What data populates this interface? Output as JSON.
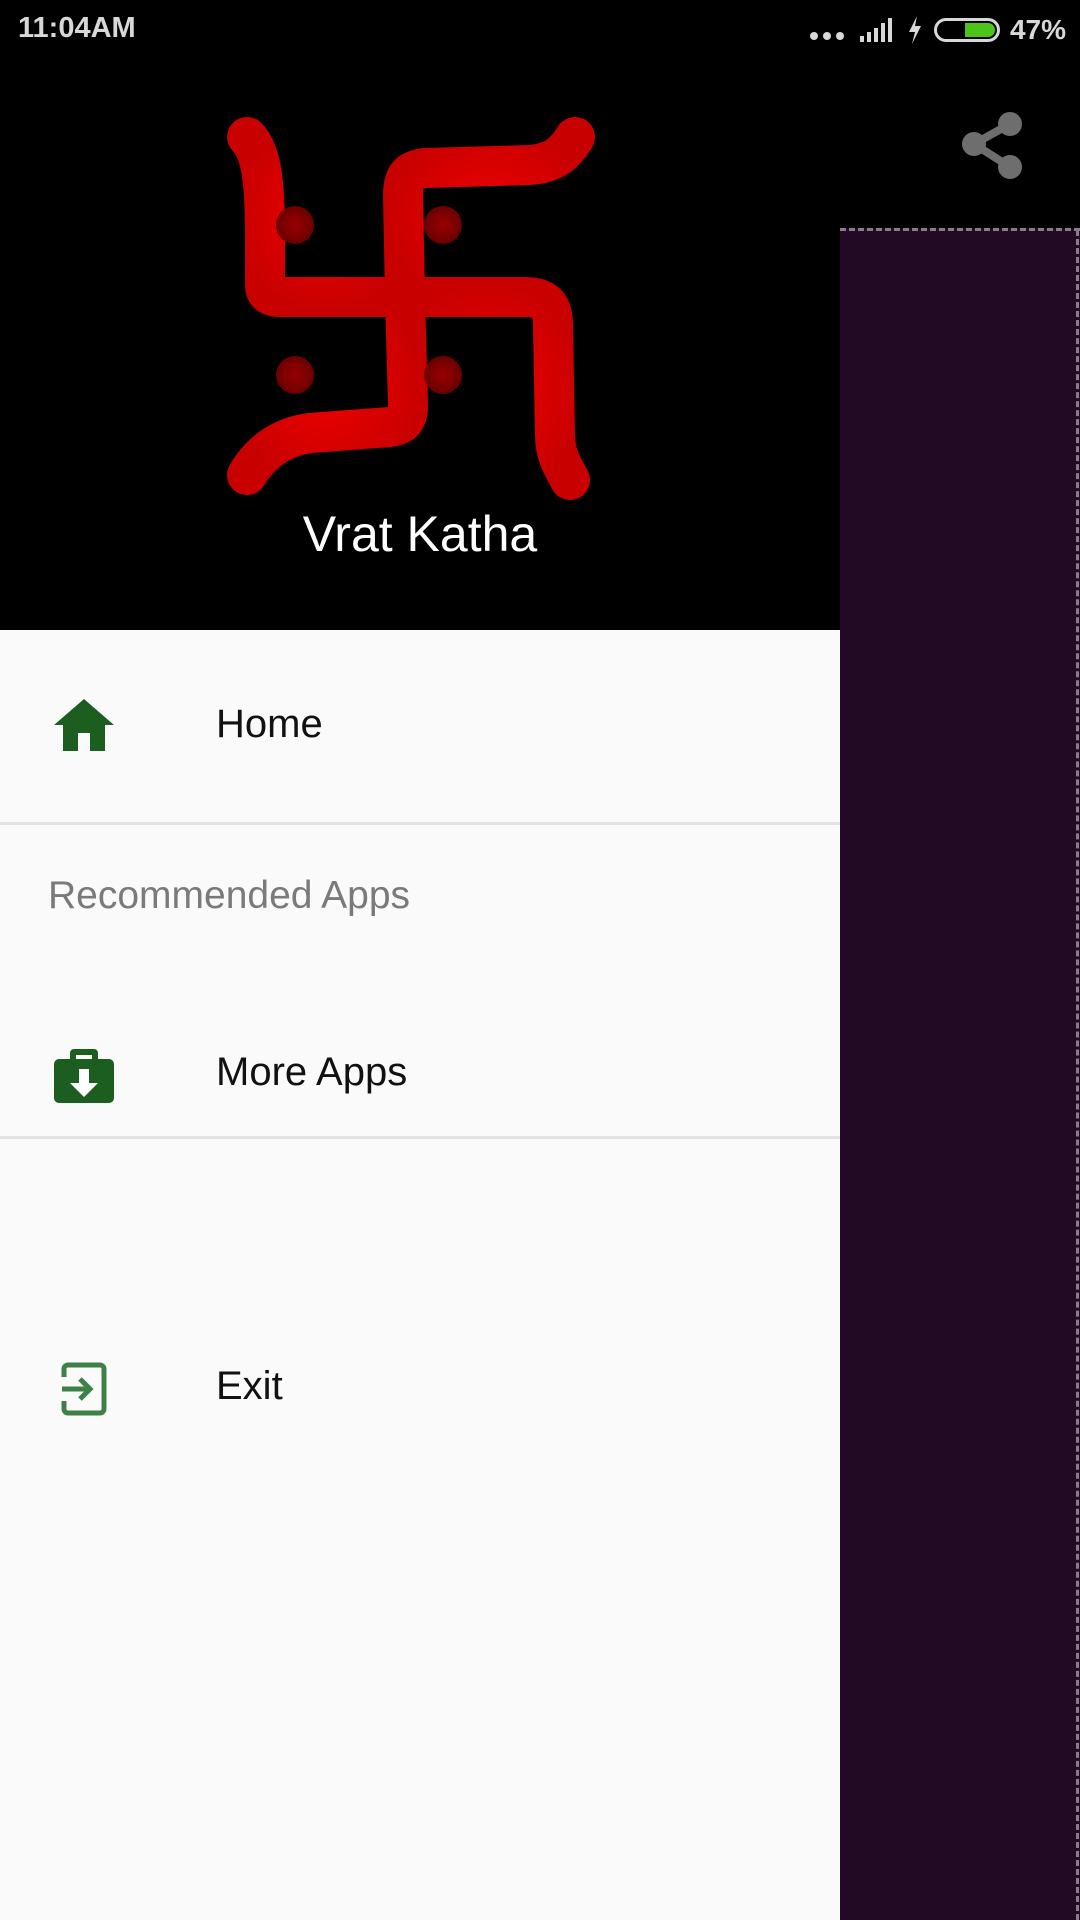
{
  "status_bar": {
    "time": "11:04AM",
    "battery_percent_text": "47%",
    "battery_level": 0.47,
    "icons": [
      "more-dots-icon",
      "signal-icon",
      "charging-bolt-icon",
      "battery-icon"
    ]
  },
  "background_app": {
    "share_icon": "share-icon"
  },
  "drawer": {
    "header": {
      "logo": "swastik-logo",
      "app_name": "Vrat Katha"
    },
    "items": [
      {
        "label": "Home",
        "icon": "home-icon"
      },
      {
        "label": "More Apps",
        "icon": "store-download-icon"
      },
      {
        "label": "Exit",
        "icon": "exit-icon"
      }
    ],
    "section_title": "Recommended Apps"
  },
  "colors": {
    "icon_green": "#1b5e20",
    "logo_red": "#e00000",
    "scrim": "#220a24",
    "battery_green": "#4cc41a"
  }
}
